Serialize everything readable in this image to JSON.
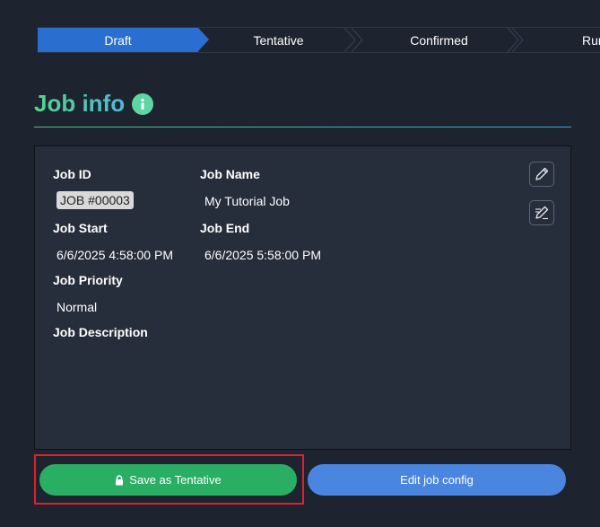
{
  "stepper": {
    "steps": [
      {
        "label": "Draft",
        "active": true
      },
      {
        "label": "Tentative",
        "active": false
      },
      {
        "label": "Confirmed",
        "active": false
      },
      {
        "label": "Runn",
        "active": false
      }
    ]
  },
  "header": {
    "title": "Job info",
    "info_icon": "info-circle-icon"
  },
  "job": {
    "id_label": "Job ID",
    "id_value": "JOB #00003",
    "name_label": "Job Name",
    "name_value": "My Tutorial Job",
    "start_label": "Job Start",
    "start_value": "6/6/2025 4:58:00 PM",
    "end_label": "Job End",
    "end_value": "6/6/2025 5:58:00 PM",
    "priority_label": "Job Priority",
    "priority_value": "Normal",
    "description_label": "Job Description",
    "description_value": ""
  },
  "actions": {
    "edit_icon": "pencil-icon",
    "edit_details_icon": "pencil-lines-icon",
    "save_label": "Save as Tentative",
    "save_icon": "lock-icon",
    "edit_config_label": "Edit job config"
  },
  "colors": {
    "background": "#1e2330",
    "card": "#262d3b",
    "active_step": "#2a6fcf",
    "save_button": "#2aae63",
    "edit_button": "#4a86e0",
    "highlight": "#e0202a"
  }
}
